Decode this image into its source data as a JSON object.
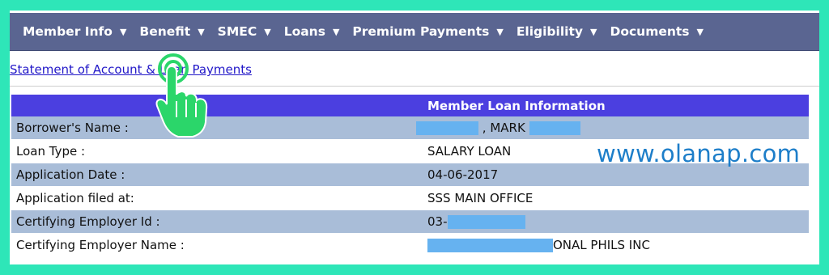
{
  "nav": {
    "items": [
      {
        "label": "Member Info",
        "caret": "▼"
      },
      {
        "label": "Benefit",
        "caret": "▼"
      },
      {
        "label": "SMEC",
        "caret": "▼"
      },
      {
        "label": "Loans",
        "caret": "▼"
      },
      {
        "label": "Premium Payments",
        "caret": "▼"
      },
      {
        "label": "Eligibility",
        "caret": "▼"
      },
      {
        "label": "Documents",
        "caret": "▼"
      }
    ]
  },
  "links": {
    "statement": "Statement of Account & Loan Payments"
  },
  "table": {
    "header": "Member Loan Information",
    "rows": [
      {
        "label": "Borrower's Name :",
        "value": ", MARK"
      },
      {
        "label": "Loan Type :",
        "value": "SALARY LOAN"
      },
      {
        "label": "Application Date :",
        "value": "04-06-2017"
      },
      {
        "label": "Application filed at:",
        "value": "SSS MAIN OFFICE"
      },
      {
        "label": "Certifying Employer Id :",
        "value": "03-"
      },
      {
        "label": "Certifying Employer Name :",
        "value": "ONAL PHILS INC"
      }
    ]
  },
  "watermark": "www.olanap.com",
  "colors": {
    "border": "#2ee6b8",
    "nav_bg": "#5a6591",
    "header_bg": "#4b3fe0",
    "row_shade": "#a9bdd8",
    "redaction": "#66b2f0",
    "link": "#2218c8",
    "cursor_hand": "#2bd66a"
  },
  "icons": {
    "pointer": "hand-pointer-icon"
  }
}
